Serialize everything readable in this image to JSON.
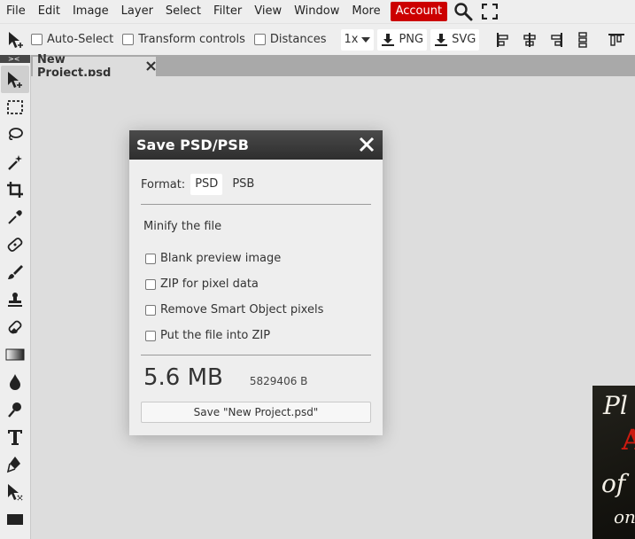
{
  "menu": {
    "items": [
      "File",
      "Edit",
      "Image",
      "Layer",
      "Select",
      "Filter",
      "View",
      "Window",
      "More"
    ],
    "account_label": "Account"
  },
  "options_bar": {
    "auto_select": "Auto-Select",
    "transform_controls": "Transform controls",
    "distances": "Distances",
    "zoom": "1x",
    "png_label": "PNG",
    "svg_label": "SVG"
  },
  "toolbar": {
    "collapse_label": "><",
    "tools": [
      "move-tool-icon",
      "marquee-icon",
      "lasso-icon",
      "magic-wand-icon",
      "crop-icon",
      "eyedropper-icon",
      "healing-icon",
      "brush-icon",
      "stamp-icon",
      "eraser-icon",
      "gradient-icon",
      "blur-drop-icon",
      "dodge-icon",
      "text-icon",
      "pen-icon",
      "path-select-icon",
      "shape-icon"
    ]
  },
  "document_tab": {
    "title": "New Project.psd"
  },
  "canvas_art": {
    "line1": "Pl",
    "line2": "A",
    "line3": "of",
    "line4": "on"
  },
  "dialog": {
    "title": "Save PSD/PSB",
    "format_label": "Format:",
    "formats": [
      "PSD",
      "PSB"
    ],
    "selected_format": "PSD",
    "minify_label": "Minify the file",
    "options": [
      "Blank preview image",
      "ZIP for pixel data",
      "Remove Smart Object pixels",
      "Put the file into ZIP"
    ],
    "size_human": "5.6 MB",
    "size_bytes": "5829406 B",
    "save_button": "Save \"New Project.psd\""
  },
  "colors": {
    "account_bg": "#cc0000",
    "dialog_title_bg": "#3a3a3a",
    "canvas_bg": "#dddddd"
  }
}
